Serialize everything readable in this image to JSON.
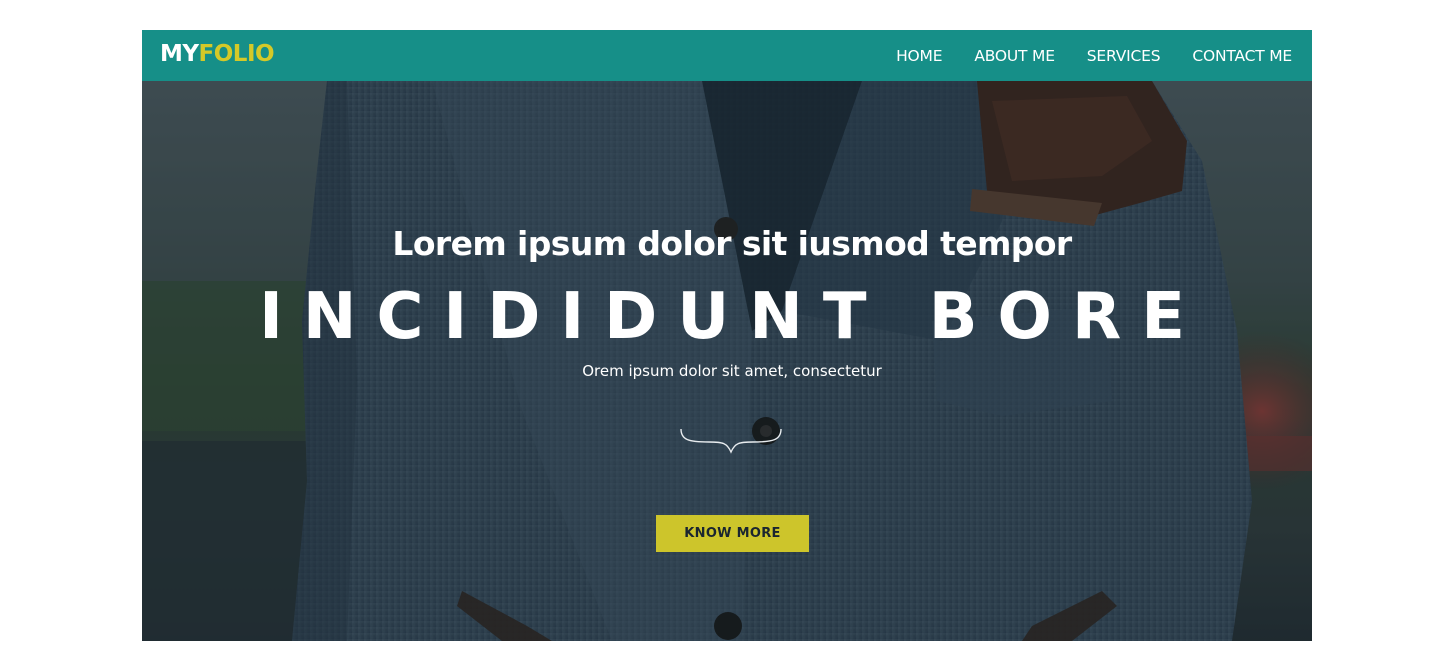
{
  "brand": {
    "prefix": "MY",
    "suffix": "FOLIO",
    "prefix_color": "#ffffff",
    "suffix_color": "#d4c928"
  },
  "nav": {
    "items": [
      {
        "label": "HOME"
      },
      {
        "label": "ABOUT ME"
      },
      {
        "label": "SERVICES"
      },
      {
        "label": "CONTACT ME"
      }
    ],
    "background_color": "#168f88"
  },
  "hero": {
    "tagline": "Lorem ipsum dolor sit iusmod tempor",
    "headline": "INCIDIDUNT BORE",
    "subline": "Orem ipsum dolor sit amet, consectetur",
    "divider_icon": "curly-brace-divider-icon",
    "cta_label": "KNOW MORE",
    "cta_color": "#cdc52b",
    "background_image": "man-in-grey-wool-coat-photo"
  }
}
